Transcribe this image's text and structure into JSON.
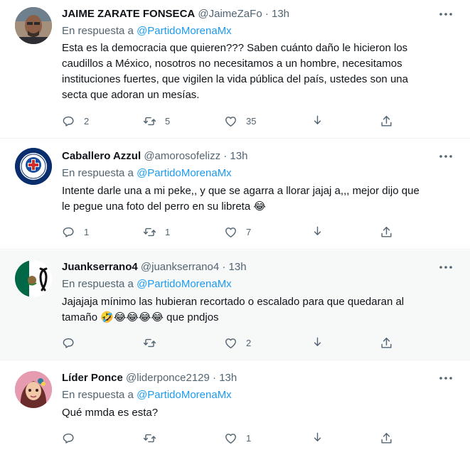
{
  "tweets": [
    {
      "name": "JAIME ZARATE FONSECA",
      "handle": "@JaimeZaFo",
      "separator": "·",
      "time": "13h",
      "reply_prefix": "En respuesta a",
      "reply_to": "@PartidoMorenaMx",
      "text_lines": [
        "Esta es la democracia que quieren??? Saben cuánto daño le hicieron los",
        "caudillos a México, nosotros no necesitamos a un hombre, necesitamos",
        "instituciones fuertes, que vigilen la vida pública del país, ustedes son una",
        "secta que adoran un mesías."
      ],
      "replies": "2",
      "retweets": "5",
      "likes": "35",
      "avatar_icon": "man-photo-avatar"
    },
    {
      "name": "Caballero Azzul",
      "handle": "@amorosofelizz",
      "separator": "·",
      "time": "13h",
      "reply_prefix": "En respuesta a",
      "reply_to": "@PartidoMorenaMx",
      "text_lines": [
        "Intente darle una a mi peke,, y que se agarra a llorar jajaj a,,, mejor dijo que",
        "le pegue una foto del perro en su libreta 😂"
      ],
      "replies": "1",
      "retweets": "1",
      "likes": "7",
      "avatar_icon": "cruz-azul-crest-avatar"
    },
    {
      "name": "Juankserrano4",
      "handle": "@juankserrano4",
      "separator": "·",
      "time": "13h",
      "reply_prefix": "En respuesta a",
      "reply_to": "@PartidoMorenaMx",
      "text_lines": [
        "Jajajaja mínimo las hubieran recortado o escalado para que quedaran al",
        "tamaño 🤣😂😂😂😂 que pndjos"
      ],
      "replies": "",
      "retweets": "",
      "likes": "2",
      "avatar_icon": "mexico-flag-ribbon-avatar"
    },
    {
      "name": "Líder Ponce",
      "handle": "@liderponce2129",
      "separator": "·",
      "time": "13h",
      "reply_prefix": "En respuesta a",
      "reply_to": "@PartidoMorenaMx",
      "text_lines": [
        "Qué mmda es esta?"
      ],
      "replies": "",
      "retweets": "",
      "likes": "1",
      "avatar_icon": "girl-illustration-avatar"
    }
  ],
  "colors": {
    "link": "#1d9bf0",
    "secondary": "#536471",
    "divider": "#eff3f4",
    "highlight_bg": "#f7f9f9"
  },
  "icons": [
    "more-icon",
    "reply-icon",
    "retweet-icon",
    "like-icon",
    "share-icon"
  ]
}
